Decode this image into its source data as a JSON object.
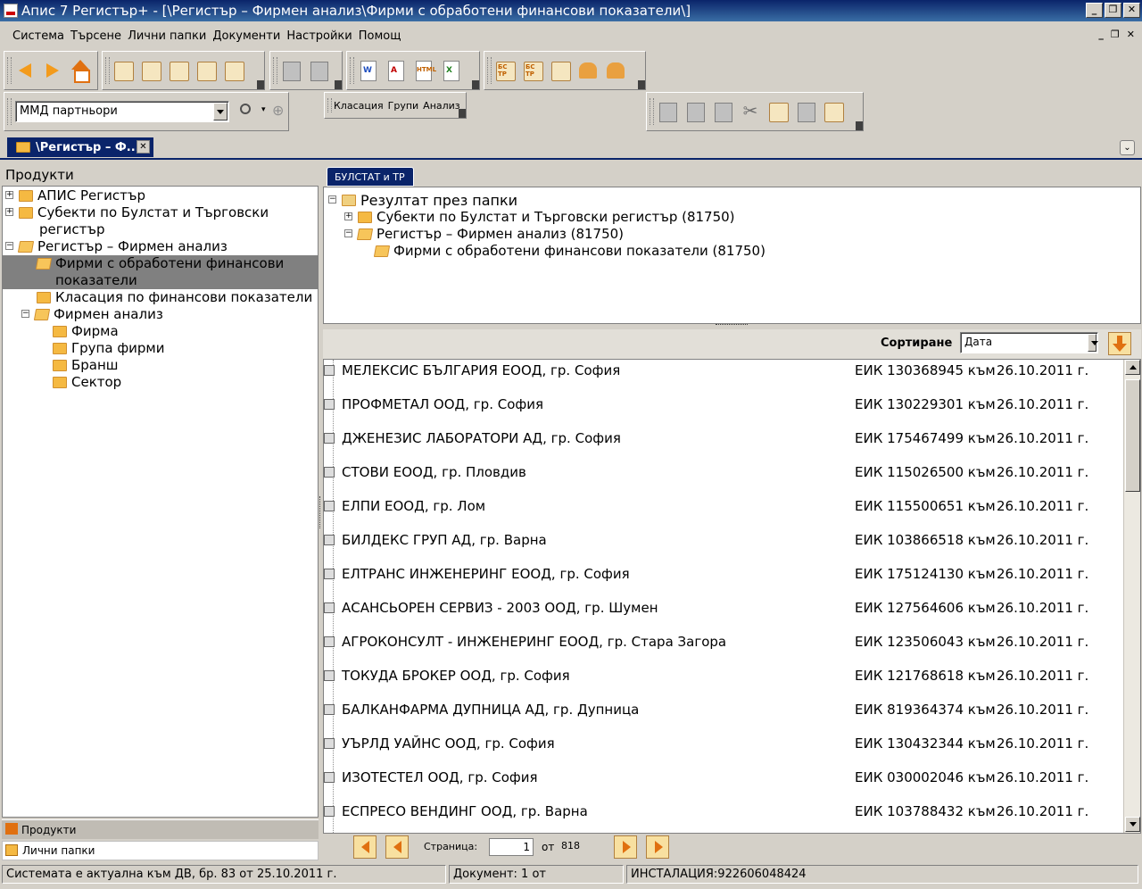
{
  "window": {
    "title": "Апис 7 Регистър+ - [\\Регистър – Фирмен анализ\\Фирми с обработени финансови показатели\\]"
  },
  "menu": [
    "Система",
    "Търсене",
    "Лични папки",
    "Документи",
    "Настройки",
    "Помощ"
  ],
  "toolbar": {
    "partner_combo": "ММД партньори",
    "links": [
      "Класация",
      "Групи",
      "Анализ"
    ],
    "doc_icons": {
      "word": "W",
      "pdf": "A",
      "html": "HTML",
      "excel": "X"
    },
    "bstr_icons": [
      "БС ТР",
      "БС ТР"
    ]
  },
  "doc_tab": "\\Регистър – Ф...",
  "left_panel": {
    "title": "Продукти",
    "tree": [
      "АПИС Регистър",
      "Субекти по Булстат и Търговски",
      "регистър",
      "Регистър – Фирмен анализ",
      "Фирми с обработени финансови",
      "показатели",
      "Класация по финансови показатели",
      "Фирмен анализ",
      "Фирма",
      "Група фирми",
      "Бранш",
      "Сектор"
    ],
    "bottom_tabs": [
      "Продукти",
      "Лични папки"
    ]
  },
  "right_panel": {
    "tab": "БУЛСТАТ и ТР",
    "result_tree": [
      "Резултат през папки",
      "Субекти по Булстат и Търговски регистър (81750)",
      "Регистър – Фирмен анализ (81750)",
      "Фирми с обработени финансови показатели (81750)"
    ],
    "sort_label": "Сортиране",
    "sort_value": "Дата"
  },
  "rows": [
    {
      "name": "МЕЛЕКСИС БЪЛГАРИЯ ЕООД, гр. София",
      "eik": "ЕИК 130368945 към",
      "date": "26.10.2011 г."
    },
    {
      "name": "ПРОФМЕТАЛ ООД, гр. София",
      "eik": "ЕИК 130229301 към",
      "date": "26.10.2011 г."
    },
    {
      "name": "ДЖЕНЕЗИС ЛАБОРАТОРИ АД, гр. София",
      "eik": "ЕИК 175467499 към",
      "date": "26.10.2011 г."
    },
    {
      "name": "СТОВИ ЕООД, гр. Пловдив",
      "eik": "ЕИК 115026500 към",
      "date": "26.10.2011 г."
    },
    {
      "name": "ЕЛПИ ЕООД, гр. Лом",
      "eik": "ЕИК 115500651 към",
      "date": "26.10.2011 г."
    },
    {
      "name": "БИЛДЕКС ГРУП АД, гр. Варна",
      "eik": "ЕИК 103866518 към",
      "date": "26.10.2011 г."
    },
    {
      "name": "ЕЛТРАНС ИНЖЕНЕРИНГ ЕООД, гр. София",
      "eik": "ЕИК 175124130 към",
      "date": "26.10.2011 г."
    },
    {
      "name": "АСАНСЬОРЕН СЕРВИЗ - 2003 ООД, гр. Шумен",
      "eik": "ЕИК 127564606 към",
      "date": "26.10.2011 г."
    },
    {
      "name": "АГРОКОНСУЛТ - ИНЖЕНЕРИНГ ЕООД, гр. Стара Загора",
      "eik": "ЕИК 123506043 към",
      "date": "26.10.2011 г."
    },
    {
      "name": "ТОКУДА БРОКЕР ООД, гр. София",
      "eik": "ЕИК 121768618 към",
      "date": "26.10.2011 г."
    },
    {
      "name": "БАЛКАНФАРМА  ДУПНИЦА АД, гр. Дупница",
      "eik": "ЕИК 819364374 към",
      "date": "26.10.2011 г."
    },
    {
      "name": "УЪРЛД УАЙНС ООД, гр. София",
      "eik": "ЕИК 130432344 към",
      "date": "26.10.2011 г."
    },
    {
      "name": "ИЗОТЕСТЕЛ ООД, гр. София",
      "eik": "ЕИК 030002046 към",
      "date": "26.10.2011 г."
    },
    {
      "name": "ЕСПРЕСО ВЕНДИНГ ООД, гр. Варна",
      "eik": "ЕИК 103788432 към",
      "date": "26.10.2011 г."
    }
  ],
  "pager": {
    "label": "Страница:",
    "page": "1",
    "of_label": "от",
    "total": "818"
  },
  "status": {
    "actuality": "Системата е актуална към ДВ, бр. 83 от 25.10.2011 г.",
    "document": "Документ: 1 от",
    "install": "ИНСТАЛАЦИЯ:922606048424"
  },
  "colors": {
    "titlebar": "#0a246a",
    "accent": "#f39b1c",
    "selection": "#808080"
  }
}
